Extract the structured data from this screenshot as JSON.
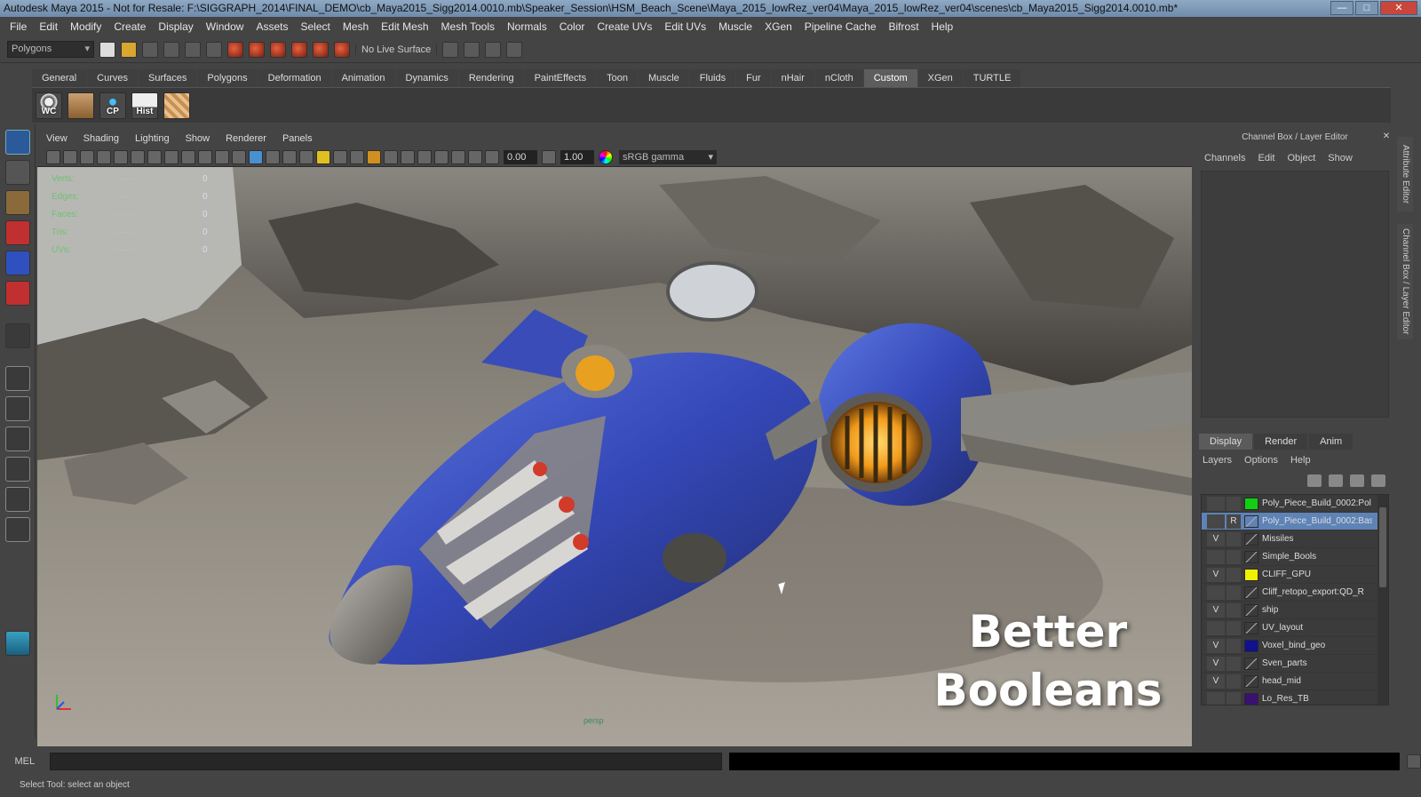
{
  "window": {
    "title": "Autodesk Maya 2015 - Not for Resale: F:\\SIGGRAPH_2014\\FINAL_DEMO\\cb_Maya2015_Sigg2014.0010.mb\\Speaker_Session\\HSM_Beach_Scene\\Maya_2015_lowRez_ver04\\Maya_2015_lowRez_ver04\\scenes\\cb_Maya2015_Sigg2014.0010.mb*",
    "minimize": "—",
    "maximize": "□",
    "close": "✕"
  },
  "menubar": [
    "File",
    "Edit",
    "Modify",
    "Create",
    "Display",
    "Window",
    "Assets",
    "Select",
    "Mesh",
    "Edit Mesh",
    "Mesh Tools",
    "Normals",
    "Color",
    "Create UVs",
    "Edit UVs",
    "Muscle",
    "XGen",
    "Pipeline Cache",
    "Bifrost",
    "Help"
  ],
  "statusline": {
    "mode": "Polygons",
    "live_surface": "No Live Surface"
  },
  "shelf_tabs": [
    "General",
    "Curves",
    "Surfaces",
    "Polygons",
    "Deformation",
    "Animation",
    "Dynamics",
    "Rendering",
    "PaintEffects",
    "Toon",
    "Muscle",
    "Fluids",
    "Fur",
    "nHair",
    "nCloth",
    "Custom",
    "XGen",
    "TURTLE"
  ],
  "shelf_tabs_active": "Custom",
  "shelf_buttons": [
    {
      "label": "WC",
      "icon": "eye-icon"
    },
    {
      "label": "",
      "icon": "hands-icon"
    },
    {
      "label": "CP",
      "icon": "pivot-icon"
    },
    {
      "label": "Hist",
      "icon": "history-icon"
    },
    {
      "label": "",
      "icon": "uv-map-icon"
    }
  ],
  "panel_menu": [
    "View",
    "Shading",
    "Lighting",
    "Show",
    "Renderer",
    "Panels"
  ],
  "panel_toolbar": {
    "exposure": "0.00",
    "gamma": "1.00",
    "color_space": "sRGB gamma"
  },
  "hud": [
    {
      "label": "Verts:",
      "value": "0"
    },
    {
      "label": "Edges:",
      "value": "0"
    },
    {
      "label": "Faces:",
      "value": "0"
    },
    {
      "label": "Tris:",
      "value": "0"
    },
    {
      "label": "UVs:",
      "value": "0"
    }
  ],
  "overlay_text": {
    "line1": "Better",
    "line2": "Booleans"
  },
  "camera_label": "persp",
  "channel_box": {
    "title": "Channel Box / Layer Editor",
    "menu": [
      "Channels",
      "Edit",
      "Object",
      "Show"
    ]
  },
  "layer_editor": {
    "tabs": [
      "Display",
      "Render",
      "Anim"
    ],
    "active_tab": "Display",
    "menu": [
      "Layers",
      "Options",
      "Help"
    ],
    "layers": [
      {
        "vis": "",
        "type": "",
        "color": "#10d010",
        "name": "Poly_Piece_Build_0002:Pol",
        "selected": false
      },
      {
        "vis": "",
        "type": "R",
        "color": "",
        "name": "Poly_Piece_Build_0002:Bas",
        "selected": true
      },
      {
        "vis": "V",
        "type": "",
        "color": "",
        "name": "Missiles",
        "selected": false
      },
      {
        "vis": "",
        "type": "",
        "color": "",
        "name": "Simple_Bools",
        "selected": false
      },
      {
        "vis": "V",
        "type": "",
        "color": "#f0f000",
        "name": "CLIFF_GPU",
        "selected": false
      },
      {
        "vis": "",
        "type": "",
        "color": "",
        "name": "Cliff_retopo_export:QD_R",
        "selected": false
      },
      {
        "vis": "V",
        "type": "",
        "color": "",
        "name": "ship",
        "selected": false
      },
      {
        "vis": "",
        "type": "",
        "color": "",
        "name": "UV_layout",
        "selected": false
      },
      {
        "vis": "V",
        "type": "",
        "color": "#101090",
        "name": "Voxel_bind_geo",
        "selected": false
      },
      {
        "vis": "V",
        "type": "",
        "color": "",
        "name": "Sven_parts",
        "selected": false
      },
      {
        "vis": "V",
        "type": "",
        "color": "",
        "name": "head_mid",
        "selected": false
      },
      {
        "vis": "",
        "type": "",
        "color": "#3a1070",
        "name": "Lo_Res_TB",
        "selected": false
      }
    ]
  },
  "side_tabs": [
    "Attribute Editor",
    "Channel Box / Layer Editor"
  ],
  "command_line": {
    "label": "MEL"
  },
  "help_line": "Select Tool: select an object"
}
